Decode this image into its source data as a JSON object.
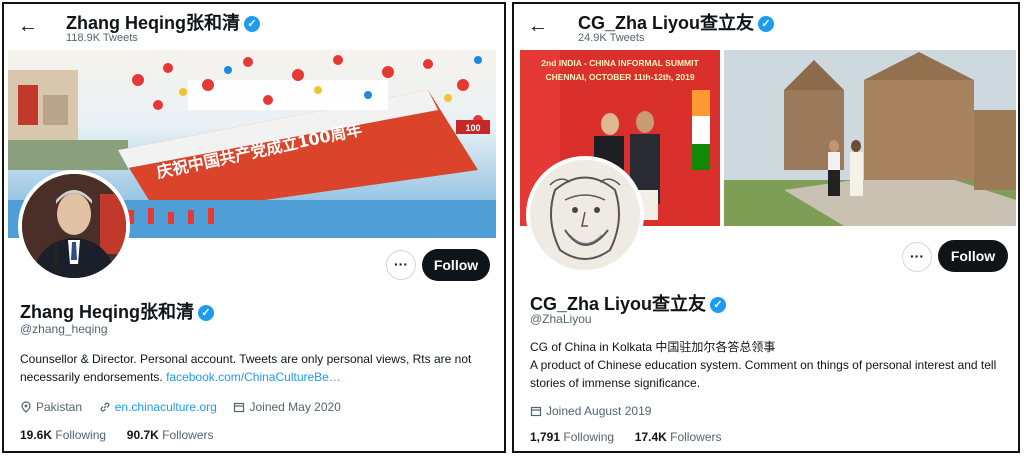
{
  "left": {
    "display_name": "Zhang Heqing张和清",
    "tweet_count": "118.9K Tweets",
    "handle": "@zhang_heqing",
    "bio": "Counsellor & Director. Personal account. Tweets are only personal views, Rts are not necessarily endorsements.",
    "bio_link": "facebook.com/ChinaCultureBe…",
    "location": "Pakistan",
    "website": "en.chinaculture.org",
    "joined": "Joined May 2020",
    "following_count": "19.6K",
    "following_label": "Following",
    "followers_count": "90.7K",
    "followers_label": "Followers",
    "follow_label": "Follow",
    "more_label": "···",
    "banner_text": "庆祝中国共产党成立100周年",
    "banner_badge": "100"
  },
  "right": {
    "display_name": "CG_Zha Liyou查立友",
    "tweet_count": "24.9K Tweets",
    "handle": "@ZhaLiyou",
    "bio_line1": "CG of China in Kolkata 中国驻加尔各答总领事",
    "bio_line2": "A product of Chinese education system. Comment on things of personal interest and tell stories of immense significance.",
    "joined": "Joined August 2019",
    "following_count": "1,791",
    "following_label": "Following",
    "followers_count": "17.4K",
    "followers_label": "Followers",
    "follow_label": "Follow",
    "more_label": "···",
    "banner_text_1": "2nd INDIA - CHINA INFORMAL SUMMIT",
    "banner_text_2": "CHENNAI, OCTOBER 11th-12th, 2019"
  },
  "colors": {
    "verified": "#1d9bf0",
    "link": "#1d9bf0",
    "follow_bg": "#0f1419",
    "muted": "#536471"
  },
  "icons": {
    "back": "arrow-left-icon",
    "verified": "verified-badge-icon",
    "location": "location-pin-icon",
    "link": "link-icon",
    "calendar": "calendar-icon"
  }
}
